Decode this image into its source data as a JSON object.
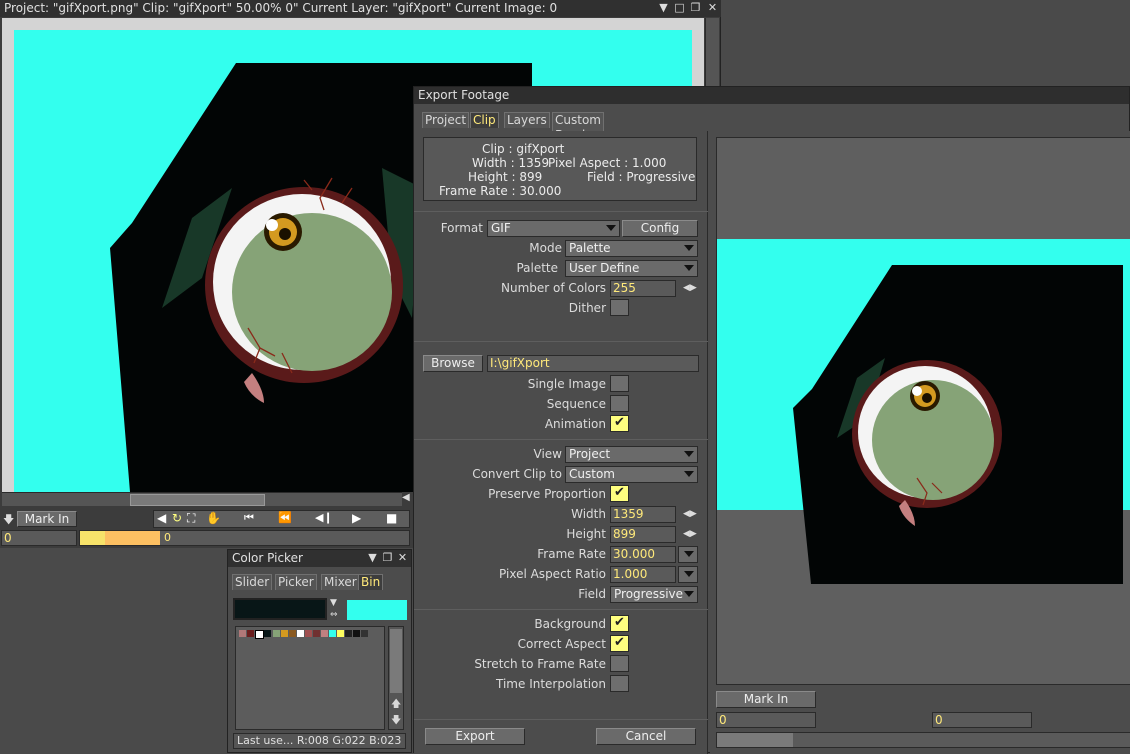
{
  "viewer": {
    "title": "Project: \"gifXport.png\"  Clip: \"gifXport\"  50.00%  0\"  Current Layer: \"gifXport\"  Current Image: 0",
    "mark_in": "Mark In",
    "frame_value": "0",
    "timeline_value": "0"
  },
  "color_picker": {
    "title": "Color Picker",
    "tabs": [
      "Slider",
      "Picker",
      "Mixer",
      "Bin"
    ],
    "active_tab": "Bin",
    "status": "Last use... R:008 G:022 B:023",
    "current_color": "#081617",
    "secondary_color": "#33ffee"
  },
  "export": {
    "title": "Export Footage",
    "tabs": [
      "Project",
      "Clip",
      "Layers",
      "Custom Brush"
    ],
    "info": {
      "clip": "Clip : gifXport",
      "width": "Width : 1359",
      "pixel_aspect": "Pixel Aspect : 1.000",
      "height": "Height : 899",
      "field": "Field : Progressive",
      "frame_rate": "Frame Rate : 30.000"
    },
    "format": {
      "label": "Format",
      "value": "GIF",
      "config": "Config"
    },
    "mode": {
      "label": "Mode",
      "value": "Palette"
    },
    "palette": {
      "label": "Palette",
      "value": "User Define"
    },
    "num_colors": {
      "label": "Number of Colors",
      "value": "255"
    },
    "dither": {
      "label": "Dither"
    },
    "browse": {
      "label": "Browse",
      "path": "I:\\gifXport"
    },
    "single_image": "Single Image",
    "sequence": "Sequence",
    "animation": "Animation",
    "view": {
      "label": "View",
      "value": "Project"
    },
    "convert_clip": {
      "label": "Convert Clip to",
      "value": "Custom"
    },
    "preserve_proportion": "Preserve Proportion",
    "width": {
      "label": "Width",
      "value": "1359"
    },
    "height": {
      "label": "Height",
      "value": "899"
    },
    "frame_rate": {
      "label": "Frame Rate",
      "value": "30.000"
    },
    "pixel_aspect": {
      "label": "Pixel Aspect Ratio",
      "value": "1.000"
    },
    "field": {
      "label": "Field",
      "value": "Progressive"
    },
    "background": "Background",
    "correct_aspect": "Correct Aspect",
    "stretch": "Stretch to Frame Rate",
    "time_interp": "Time Interpolation",
    "export_btn": "Export",
    "cancel_btn": "Cancel",
    "preview_mark_in": "Mark In",
    "preview_in": "0",
    "preview_out": "0"
  },
  "colors": {
    "cyan": "#33ffee",
    "checked": "#ffff80",
    "value_text": "#ffe97a"
  }
}
